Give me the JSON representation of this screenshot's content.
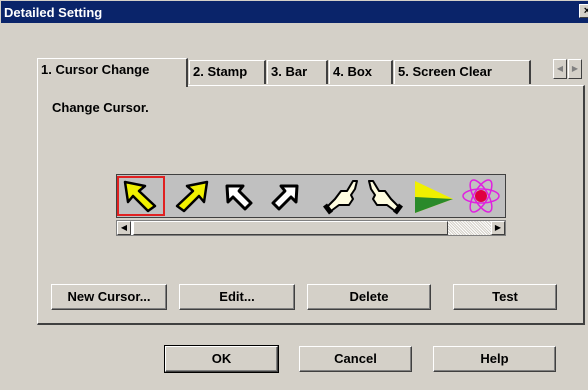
{
  "window": {
    "title": "Detailed Setting",
    "close_glyph": "×"
  },
  "tabs": [
    {
      "label": "1. Cursor Change",
      "active": true
    },
    {
      "label": "2. Stamp"
    },
    {
      "label": "3. Bar"
    },
    {
      "label": "4. Box"
    },
    {
      "label": "5. Screen Clear"
    }
  ],
  "tab_scroll": {
    "left": "◀",
    "right": "▶"
  },
  "panel": {
    "label": "Change Cursor."
  },
  "cursors": [
    {
      "name": "arrow-left-yellow-icon",
      "selected": true
    },
    {
      "name": "arrow-right-yellow-icon"
    },
    {
      "name": "arrow-left-outline-icon"
    },
    {
      "name": "arrow-right-outline-icon"
    },
    {
      "name": "pointing-hand-left-icon"
    },
    {
      "name": "pointing-hand-right-icon"
    },
    {
      "name": "triangle-pointer-icon"
    },
    {
      "name": "atom-icon"
    }
  ],
  "scrollbar": {
    "left": "◀",
    "right": "▶"
  },
  "panel_buttons": {
    "new": "New Cursor...",
    "edit": "Edit...",
    "delete": "Delete",
    "test": "Test"
  },
  "dialog_buttons": {
    "ok": "OK",
    "cancel": "Cancel",
    "help": "Help"
  },
  "colors": {
    "title_bar": "#0a246a",
    "face": "#d4d0c8",
    "selection": "#e02020",
    "cursor_fill": "#f0f000"
  }
}
